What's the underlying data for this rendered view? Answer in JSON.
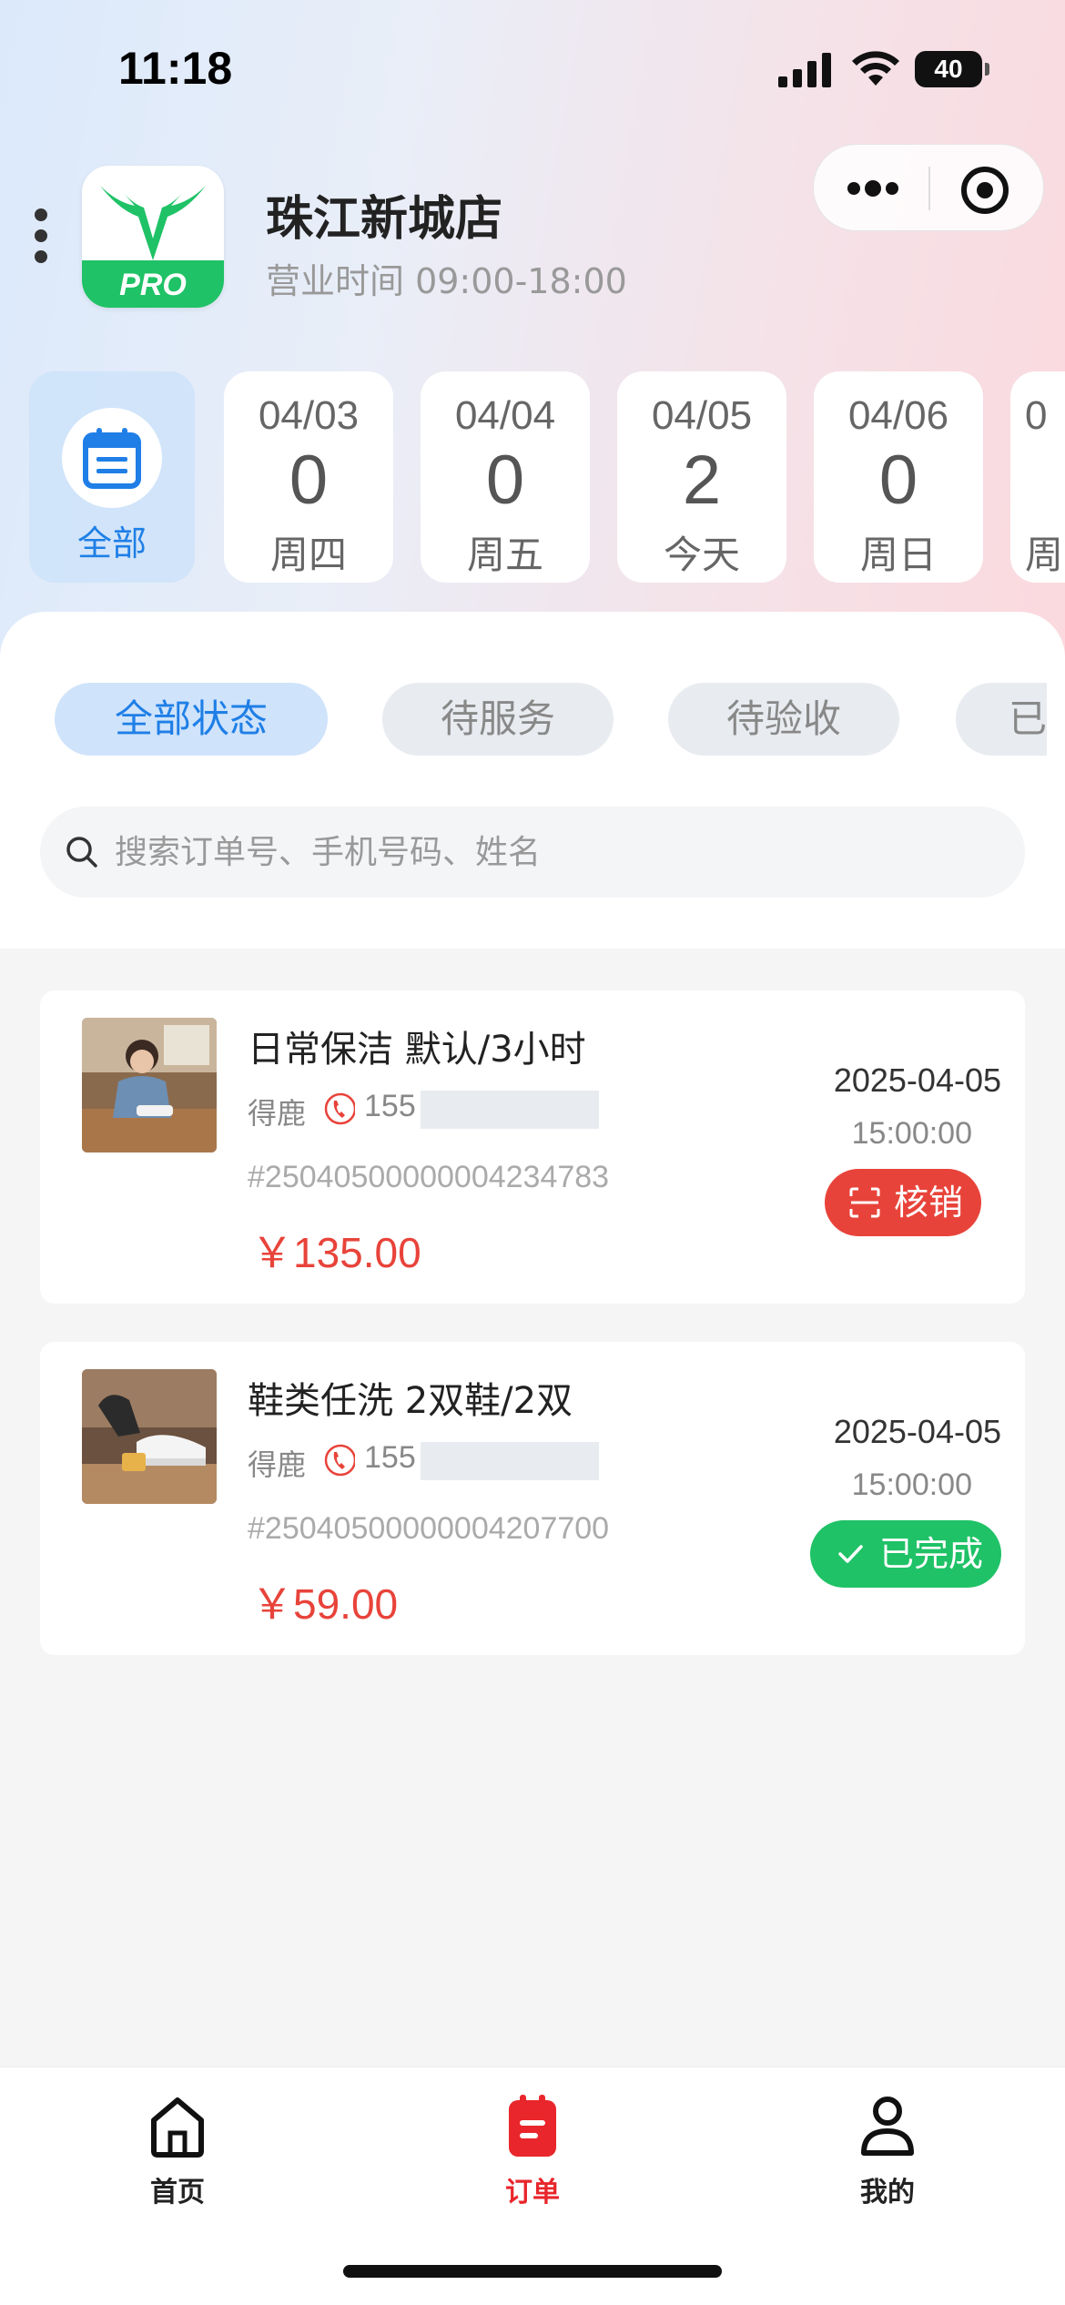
{
  "status_bar": {
    "time": "11:18",
    "battery": "40"
  },
  "store": {
    "name": "珠江新城店",
    "hours": "营业时间 09:00-18:00",
    "logo_text": "PRO"
  },
  "date_filter": {
    "all_label": "全部",
    "dates": [
      {
        "date": "04/03",
        "count": "0",
        "weekday": "周四"
      },
      {
        "date": "04/04",
        "count": "0",
        "weekday": "周五"
      },
      {
        "date": "04/05",
        "count": "2",
        "weekday": "今天"
      },
      {
        "date": "04/06",
        "count": "0",
        "weekday": "周日"
      },
      {
        "date": "0",
        "count": "",
        "weekday": "周"
      }
    ]
  },
  "status_tabs": [
    "全部状态",
    "待服务",
    "待验收",
    "已"
  ],
  "search": {
    "placeholder": "搜索订单号、手机号码、姓名"
  },
  "orders": [
    {
      "title": "日常保洁 默认/3小时",
      "customer": "得鹿",
      "phone_prefix": "155",
      "order_no": "#25040500000004234783",
      "price": "￥135.00",
      "date": "2025-04-05",
      "time": "15:00:00",
      "action": "核销",
      "action_color": "#e8433a"
    },
    {
      "title": "鞋类任洗 2双鞋/2双",
      "customer": "得鹿",
      "phone_prefix": "155",
      "order_no": "#25040500000004207700",
      "price": "￥59.00",
      "date": "2025-04-05",
      "time": "15:00:00",
      "action": "已完成",
      "action_color": "#1fc266"
    }
  ],
  "tabbar": {
    "home": "首页",
    "orders": "订单",
    "mine": "我的"
  },
  "colors": {
    "accent_blue": "#1f7fe6",
    "accent_red": "#e8262b",
    "price_red": "#e8433a",
    "success_green": "#1fc266"
  }
}
